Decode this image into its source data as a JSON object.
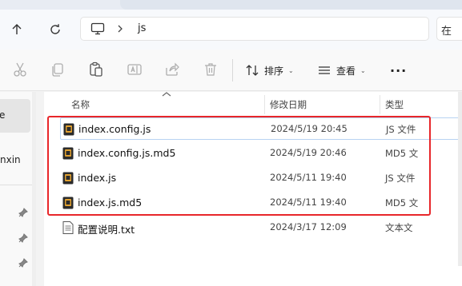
{
  "window": {
    "search_fragment": "在"
  },
  "address": {
    "location_icon": "this-pc-icon",
    "crumbs": [
      "js"
    ]
  },
  "toolbar": {
    "icons": [
      "cut-icon",
      "copy-icon",
      "paste-icon",
      "rename-icon",
      "share-icon",
      "delete-icon"
    ],
    "sort_label": "排序",
    "view_label": "查看",
    "more_label": "···"
  },
  "leftnav": {
    "item_fragment_top": "e",
    "item_fragment_user": "nxin"
  },
  "columns": {
    "name": "名称",
    "modified": "修改日期",
    "type": "类型"
  },
  "files": [
    {
      "name": "index.config.js",
      "modified": "2024/5/19 20:45",
      "type": "JS 文件"
    },
    {
      "name": "index.config.js.md5",
      "modified": "2024/5/19 20:46",
      "type": "MD5 文"
    },
    {
      "name": "index.js",
      "modified": "2024/5/11 19:40",
      "type": "JS 文件"
    },
    {
      "name": "index.js.md5",
      "modified": "2024/5/11 19:40",
      "type": "MD5 文"
    },
    {
      "name": "配置说明.txt",
      "modified": "2024/3/17 12:09",
      "type": "文本文"
    }
  ],
  "colors": {
    "highlight_box": "#e8262a",
    "focus_row_border": "#b8d3f2",
    "file_icon_dark": "#2b2b2b",
    "file_icon_accent": "#e0a030"
  }
}
